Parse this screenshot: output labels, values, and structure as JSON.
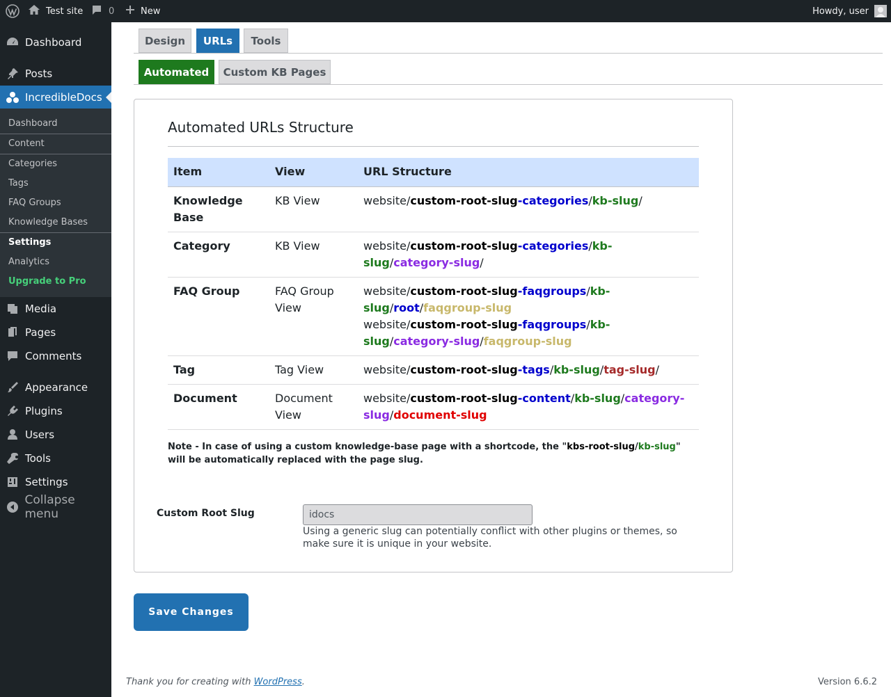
{
  "adminbar": {
    "site_name": "Test site",
    "comments_count": "0",
    "new_label": "New",
    "howdy": "Howdy, user"
  },
  "sidebar": {
    "items": [
      {
        "label": "Dashboard",
        "icon": "dashboard-icon"
      },
      {
        "label": "Posts",
        "icon": "pin-icon"
      },
      {
        "label": "IncredibleDocs",
        "icon": "docs-icon"
      },
      {
        "label": "Media",
        "icon": "media-icon"
      },
      {
        "label": "Pages",
        "icon": "pages-icon"
      },
      {
        "label": "Comments",
        "icon": "comment-icon"
      },
      {
        "label": "Appearance",
        "icon": "brush-icon"
      },
      {
        "label": "Plugins",
        "icon": "plugin-icon"
      },
      {
        "label": "Users",
        "icon": "user-icon"
      },
      {
        "label": "Tools",
        "icon": "wrench-icon"
      },
      {
        "label": "Settings",
        "icon": "settings-icon"
      }
    ],
    "submenu": [
      "Dashboard",
      "Content",
      "Categories",
      "Tags",
      "FAQ Groups",
      "Knowledge Bases",
      "Settings",
      "Analytics",
      "Upgrade to Pro"
    ],
    "collapse": "Collapse menu"
  },
  "tabs": {
    "primary": [
      "Design",
      "URLs",
      "Tools"
    ],
    "secondary": [
      "Automated",
      "Custom KB Pages"
    ]
  },
  "panel": {
    "title": "Automated URLs Structure",
    "headers": [
      "Item",
      "View",
      "URL Structure"
    ],
    "rows": {
      "kb": {
        "item": "Knowledge Base",
        "view": "KB View"
      },
      "category": {
        "item": "Category",
        "view": "KB View"
      },
      "faq": {
        "item": "FAQ Group",
        "view": "FAQ Group View"
      },
      "tag": {
        "item": "Tag",
        "view": "Tag View"
      },
      "document": {
        "item": "Document",
        "view": "Document View"
      }
    },
    "url": {
      "website": "website/",
      "root": "custom-root-slug",
      "categories": "-categories",
      "faqgroups": "-faqgroups",
      "tags": "-tags",
      "content": "-content",
      "kb_slug": "kb-slug",
      "category_slug": "category-slug",
      "root_word": "root",
      "faqgroup_slug": "faqgroup-slug",
      "tag_slug": "tag-slug",
      "document_slug": "document-slug",
      "slash": "/"
    },
    "note": {
      "prefix": "Note - In case of using a custom knowledge-base page with a shortcode, the \"",
      "kbs_root": "kbs-root-slug",
      "kb_slug": "kb-slug",
      "suffix": "\" will be automatically replaced with the page slug."
    },
    "slug_label": "Custom Root Slug",
    "slug_value": "idocs",
    "slug_help": "Using a generic slug can potentially conflict with other plugins or themes, so make sure it is unique in your website."
  },
  "save_label": "Save Changes",
  "footer": {
    "thanks_prefix": "Thank you for creating with ",
    "wordpress": "WordPress",
    "thanks_suffix": ".",
    "version": "Version 6.6.2"
  },
  "colors": {
    "accent": "#2271b1",
    "green_tab": "#1e7a1e",
    "table_header": "#cfe2ff",
    "upgrade": "#46d07a"
  }
}
